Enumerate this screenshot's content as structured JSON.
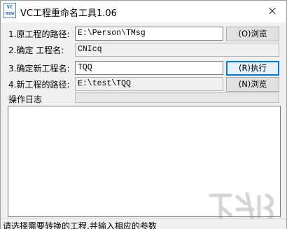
{
  "window": {
    "title": "VC工程重命名工具1.06",
    "app_icon_lines": [
      "VC",
      "new"
    ]
  },
  "rows": [
    {
      "label": "1.原工程的路径:",
      "value": "E:\\Person\\TMsg",
      "button": "(O)浏览"
    },
    {
      "label": "2.确定  工程名:",
      "value": "CNIcq"
    },
    {
      "label": "3.确定新工程名:",
      "value": "TQQ",
      "button": "(R)执行"
    },
    {
      "label": "4.新工程的路径:",
      "value": "E:\\test\\TQQ",
      "button": "(N)浏览"
    }
  ],
  "progress": {
    "fraction": 0
  },
  "log": {
    "label": "操作日志",
    "content": ""
  },
  "status": {
    "text": "请选择需要转换的工程,并输入相应的参数"
  }
}
